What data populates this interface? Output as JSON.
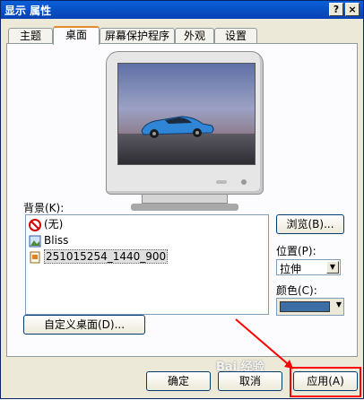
{
  "window": {
    "title": "显示 属性",
    "help_glyph": "?",
    "close_glyph": "×"
  },
  "tabs": [
    {
      "label": "主题"
    },
    {
      "label": "桌面"
    },
    {
      "label": "屏幕保护程序"
    },
    {
      "label": "外观"
    },
    {
      "label": "设置"
    }
  ],
  "background_label": "背景(K):",
  "background_items": [
    {
      "label": "(无)",
      "icon": "no-entry-icon"
    },
    {
      "label": "Bliss",
      "icon": "image-file-icon"
    },
    {
      "label": "251015254_1440_900",
      "icon": "jpeg-file-icon"
    }
  ],
  "browse_button": "浏览(B)...",
  "position": {
    "label": "位置(P):",
    "value": "拉伸"
  },
  "color": {
    "label": "颜色(C):",
    "value": "#3a6ea5"
  },
  "customize_button": "自定义桌面(D)...",
  "footer": {
    "ok": "确定",
    "cancel": "取消",
    "apply": "应用(A)"
  },
  "watermark": "Bai 经验",
  "colors": {
    "highlight_box": "#ff0000",
    "arrow": "#ff0000",
    "title_bar": "#0a5fd8"
  }
}
